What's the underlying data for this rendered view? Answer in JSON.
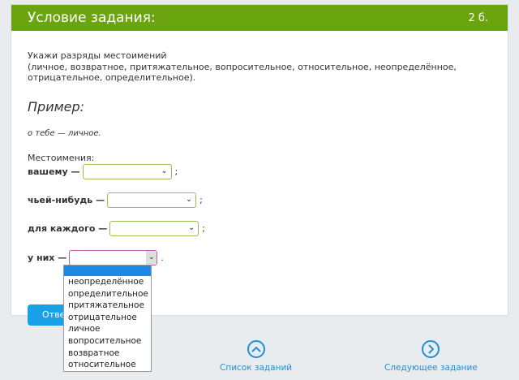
{
  "header": {
    "title": "Условие задания:",
    "points": "2 б."
  },
  "task": {
    "line1": "Укажи разряды местоимений",
    "line2": "(личное, возвратное, притяжательное, вопросительное, относительное, неопределённое, отрицательное, определительное)."
  },
  "example": {
    "heading": "Пример:",
    "text": "о тебе — личное."
  },
  "pronouns": {
    "label": "Местоимения:",
    "rows": [
      {
        "word": "вашему —",
        "sep": ";"
      },
      {
        "word": "чьей-нибудь —",
        "sep": ";"
      },
      {
        "word": "для каждого —",
        "sep": ";"
      },
      {
        "word": "у них —",
        "sep": "."
      }
    ]
  },
  "answer_button": "Ответ",
  "dropdown": {
    "options": [
      "неопределённое",
      "определительное",
      "притяжательное",
      "отрицательное",
      "личное",
      "вопросительное",
      "возвратное",
      "относительное"
    ]
  },
  "nav": {
    "list_label": "Список заданий",
    "next_label": "Следующее задание"
  },
  "colors": {
    "header": "#6aa40f",
    "accent": "#1aa0e6",
    "link": "#1f8ed4",
    "select_border": "#97bf56"
  }
}
